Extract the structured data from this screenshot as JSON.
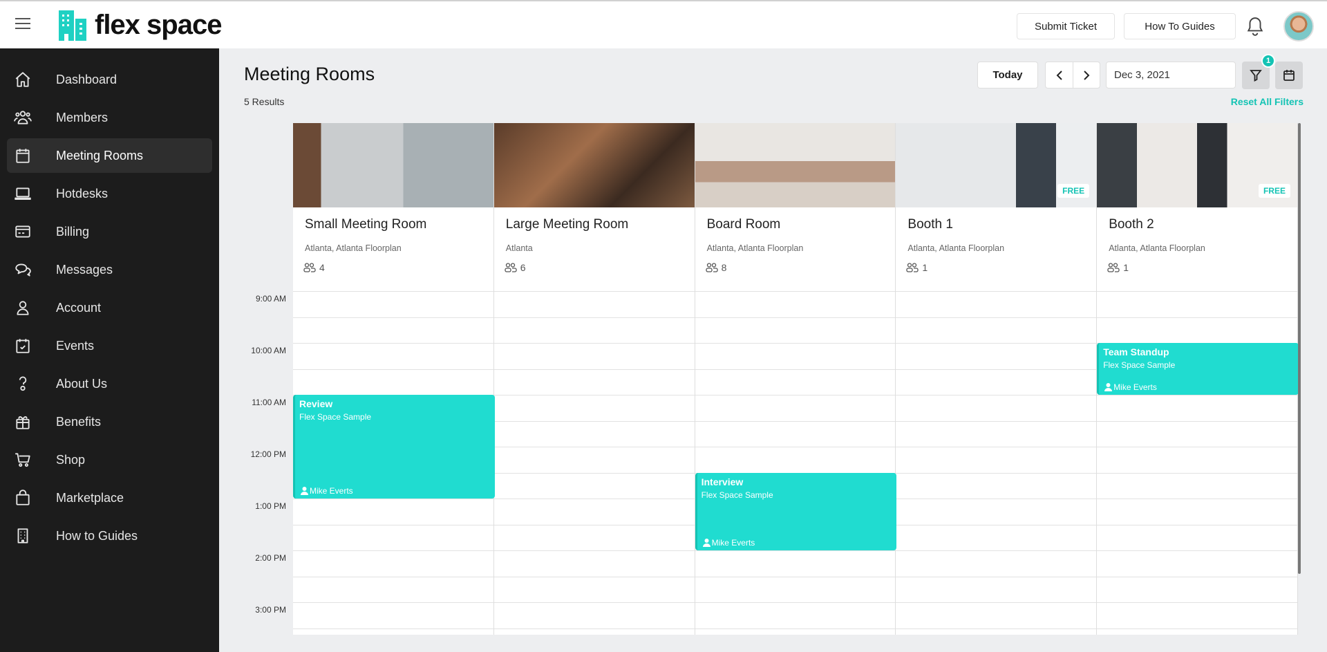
{
  "header": {
    "brand": "flex space",
    "submit_ticket": "Submit Ticket",
    "how_to_guides": "How To Guides",
    "accent": "#1fc8b8"
  },
  "sidebar": {
    "items": [
      {
        "label": "Dashboard",
        "icon": "home"
      },
      {
        "label": "Members",
        "icon": "users"
      },
      {
        "label": "Meeting Rooms",
        "icon": "calendar",
        "active": true
      },
      {
        "label": "Hotdesks",
        "icon": "laptop"
      },
      {
        "label": "Billing",
        "icon": "credit-card"
      },
      {
        "label": "Messages",
        "icon": "chat"
      },
      {
        "label": "Account",
        "icon": "user"
      },
      {
        "label": "Events",
        "icon": "calendar-check"
      },
      {
        "label": "About Us",
        "icon": "question"
      },
      {
        "label": "Benefits",
        "icon": "gift"
      },
      {
        "label": "Shop",
        "icon": "cart"
      },
      {
        "label": "Marketplace",
        "icon": "bag"
      },
      {
        "label": "How to Guides",
        "icon": "building"
      }
    ]
  },
  "main": {
    "title": "Meeting Rooms",
    "results": "5 Results",
    "today": "Today",
    "date": "Dec 3, 2021",
    "filter_count": "1",
    "reset_filters": "Reset All Filters"
  },
  "rooms": [
    {
      "name": "Small Meeting Room",
      "location": "Atlanta, Atlanta Floorplan",
      "capacity": "4",
      "free": false
    },
    {
      "name": "Large Meeting Room",
      "location": "Atlanta",
      "capacity": "6",
      "free": false
    },
    {
      "name": "Board Room",
      "location": "Atlanta, Atlanta Floorplan",
      "capacity": "8",
      "free": false
    },
    {
      "name": "Booth 1",
      "location": "Atlanta, Atlanta Floorplan",
      "capacity": "1",
      "free": true
    },
    {
      "name": "Booth 2",
      "location": "Atlanta, Atlanta Floorplan",
      "capacity": "1",
      "free": true
    }
  ],
  "free_label": "FREE",
  "times": [
    "9:00 AM",
    "10:00 AM",
    "11:00 AM",
    "12:00 PM",
    "1:00 PM",
    "2:00 PM",
    "3:00 PM"
  ],
  "events": [
    {
      "title": "Review",
      "org": "Flex Space Sample",
      "user": "Mike Everts",
      "room": 0,
      "start": 11,
      "end": 13
    },
    {
      "title": "Team Standup",
      "org": "Flex Space Sample",
      "user": "Mike Everts",
      "room": 4,
      "start": 10,
      "end": 11
    },
    {
      "title": "Interview",
      "org": "Flex Space Sample",
      "user": "Mike Everts",
      "room": 2,
      "start": 12.5,
      "end": 14
    }
  ]
}
